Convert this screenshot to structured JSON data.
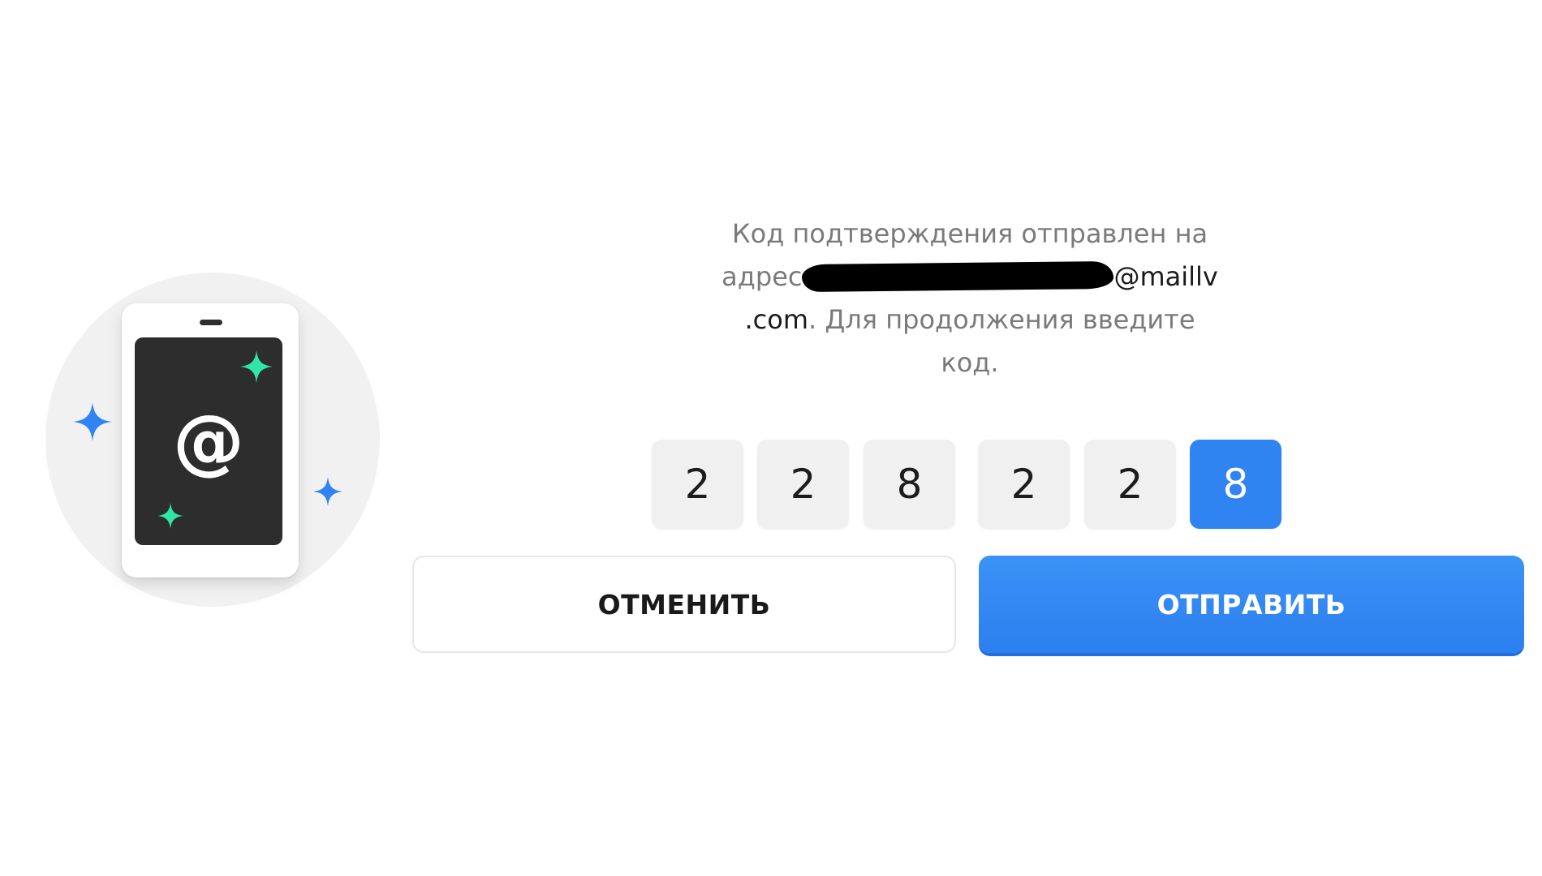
{
  "message": {
    "line1": "Код подтверждения отправлен на",
    "address_prefix": "адрес",
    "email_visible_suffix": "@maillv",
    "email_domain_end": ".com",
    "continuation": ". Для продолжения введите",
    "line4": "код."
  },
  "code": {
    "digits": [
      "2",
      "2",
      "8",
      "2",
      "2",
      "8"
    ],
    "active_index": 5
  },
  "buttons": {
    "cancel_label": "ОТМЕНИТЬ",
    "submit_label": "ОТПРАВИТЬ"
  },
  "illustration": {
    "icon": "phone-at-icon",
    "glyph": "@"
  },
  "colors": {
    "accent": "#2f84f2",
    "sparkle_blue": "#2f84f2",
    "sparkle_green": "#2ee6a6",
    "screen": "#2d2d2d",
    "code_box": "#f0f0f0",
    "message_text": "#7a7a7a",
    "email_text": "#1b1b1b"
  }
}
